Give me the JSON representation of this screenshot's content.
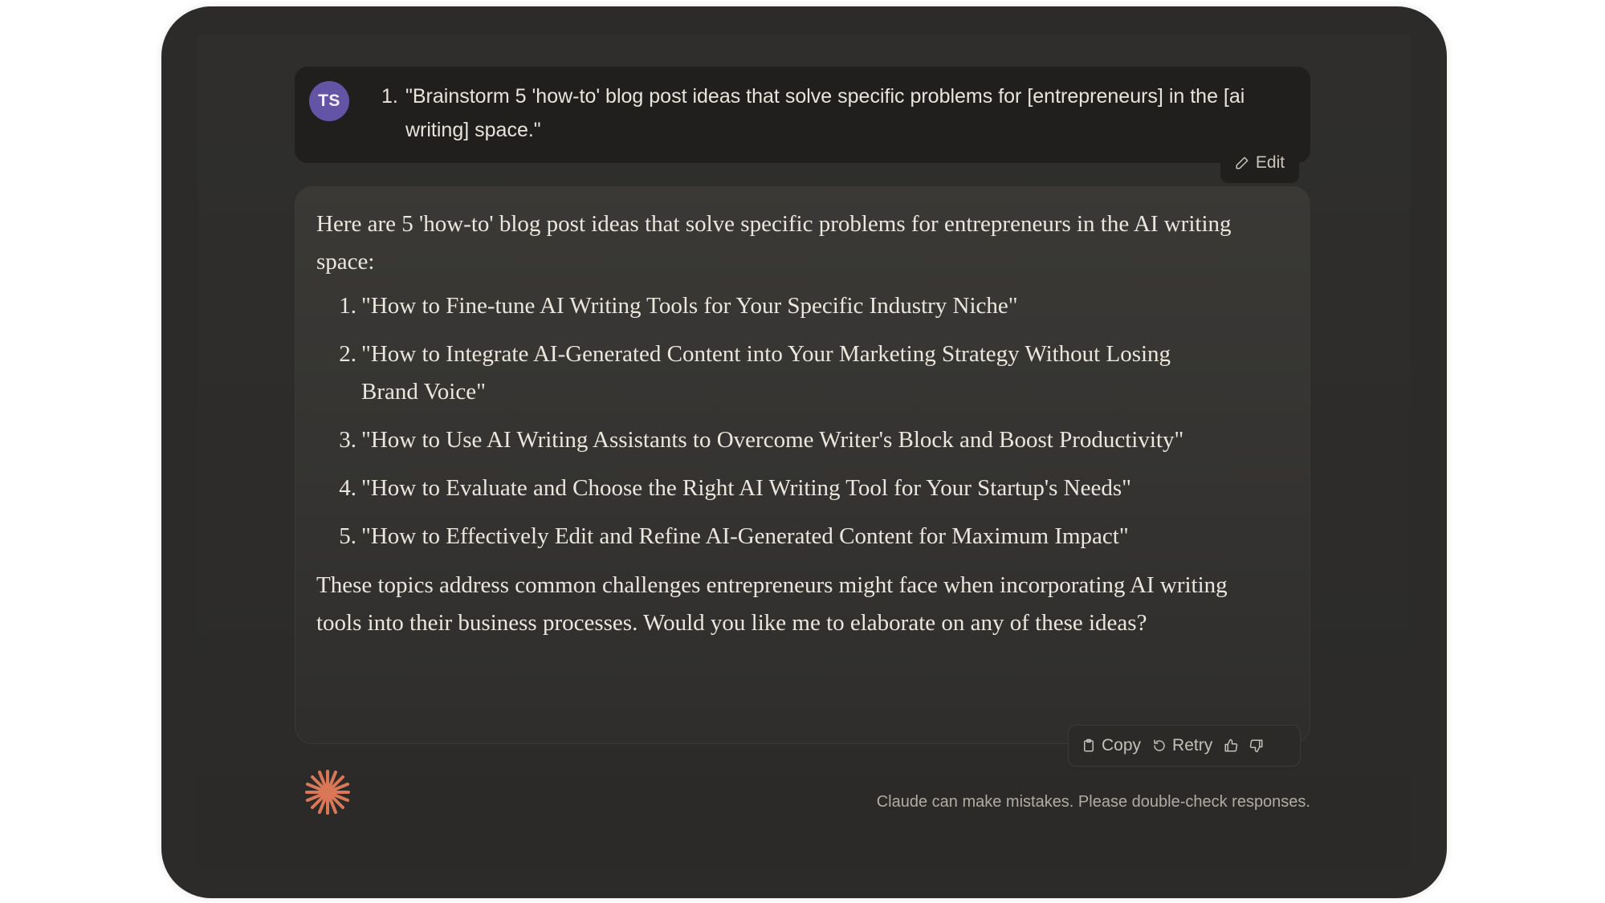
{
  "user_message": {
    "avatar_initials": "TS",
    "list_number": "1.",
    "text": "\"Brainstorm 5 'how-to' blog post ideas that solve specific problems for [entrepreneurs] in the [ai writing] space.\"",
    "edit_label": "Edit"
  },
  "assistant_message": {
    "intro": "Here are 5 'how-to' blog post ideas that solve specific problems for entrepreneurs in the AI writing space:",
    "items": [
      {
        "number": "1.",
        "text": "\"How to Fine-tune AI Writing Tools for Your Specific Industry Niche\""
      },
      {
        "number": "2.",
        "text": "\"How to Integrate AI-Generated Content into Your Marketing Strategy Without Losing Brand Voice\""
      },
      {
        "number": "3.",
        "text": "\"How to Use AI Writing Assistants to Overcome Writer's Block and Boost Productivity\""
      },
      {
        "number": "4.",
        "text": "\"How to Evaluate and Choose the Right AI Writing Tool for Your Startup's Needs\""
      },
      {
        "number": "5.",
        "text": "\"How to Effectively Edit and Refine AI-Generated Content for Maximum Impact\""
      }
    ],
    "outro": "These topics address common challenges entrepreneurs might face when incorporating AI writing tools into their business processes. Would you like me to elaborate on any of these ideas?"
  },
  "actions": {
    "copy_label": "Copy",
    "retry_label": "Retry"
  },
  "footer": {
    "disclaimer": "Claude can make mistakes. Please double-check responses."
  },
  "icons": {
    "edit": "pencil-icon",
    "copy": "clipboard-icon",
    "retry": "retry-icon",
    "thumbs_up": "thumbs-up-icon",
    "thumbs_down": "thumbs-down-icon",
    "logo": "claude-sparkle-icon"
  },
  "colors": {
    "avatar": "#6354a6",
    "logo": "#d97757",
    "background": "#2c2b29"
  }
}
